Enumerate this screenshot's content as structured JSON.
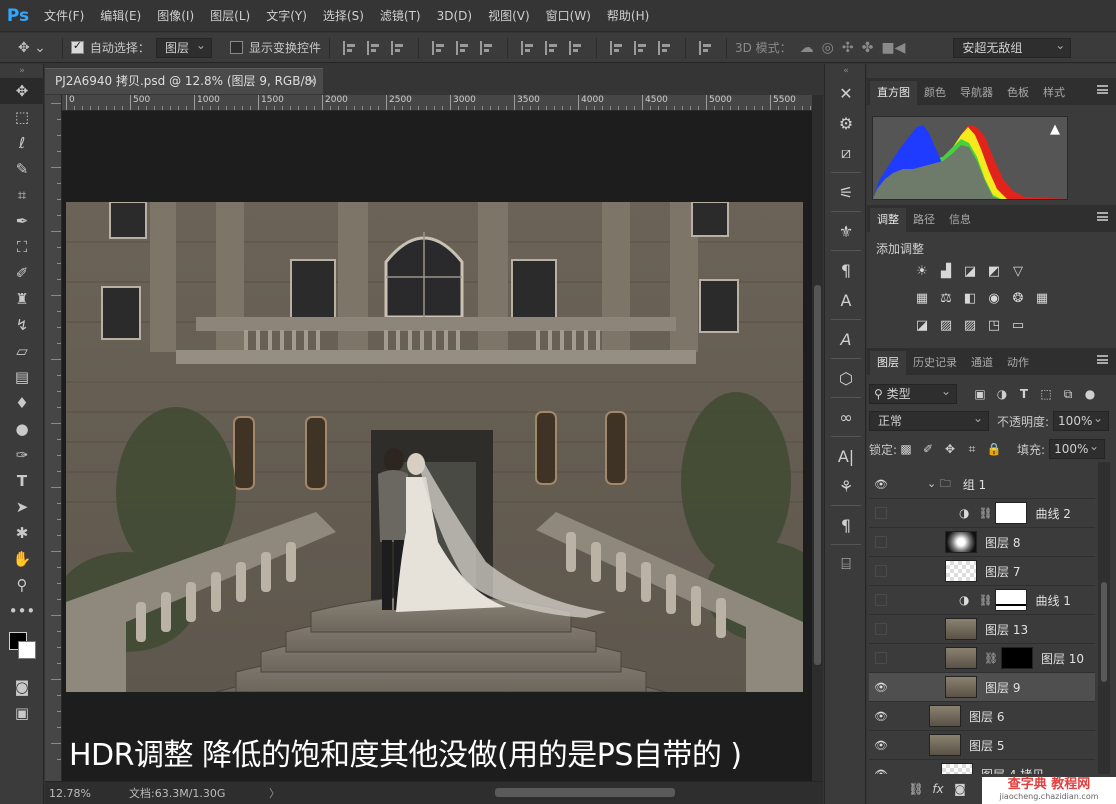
{
  "app": {
    "logo": "Ps"
  },
  "menu": [
    "文件(F)",
    "编辑(E)",
    "图像(I)",
    "图层(L)",
    "文字(Y)",
    "选择(S)",
    "滤镜(T)",
    "3D(D)",
    "视图(V)",
    "窗口(W)",
    "帮助(H)"
  ],
  "options": {
    "auto_select_label": "自动选择：",
    "auto_select_value": "图层",
    "show_transform_label": "显示变换控件",
    "mode3d_label": "3D 模式：",
    "font_value": "安超无敌组"
  },
  "document": {
    "tab_title": "PJ2A6940 拷贝.psd @ 12.8% (图层 9, RGB/8) *",
    "close": "×",
    "ruler_labels": [
      "0",
      "500",
      "1000",
      "1500",
      "2000",
      "2500",
      "3000",
      "3500",
      "4000",
      "4500",
      "5000",
      "5500"
    ],
    "caption": "HDR调整 降低的饱和度其他没做(用的是PS自带的 )"
  },
  "status": {
    "zoom": "12.78%",
    "doc_info": "文档:63.3M/1.30G",
    "arrow": "〉"
  },
  "panels": {
    "top_tabs": [
      "直方图",
      "颜色",
      "导航器",
      "色板",
      "样式"
    ],
    "mid_tabs": [
      "调整",
      "路径",
      "信息"
    ],
    "add_adjustment": "添加调整",
    "layer_tabs": [
      "图层",
      "历史记录",
      "通道",
      "动作"
    ],
    "filter_kind": "类型",
    "blend_mode": "正常",
    "opacity_label": "不透明度:",
    "opacity_value": "100%",
    "lock_label": "锁定:",
    "fill_label": "填充:",
    "fill_value": "100%"
  },
  "layers": [
    {
      "name": "组 1",
      "visible": true,
      "type": "group"
    },
    {
      "name": "曲线 2",
      "visible": false,
      "type": "adjust-white"
    },
    {
      "name": "图层 8",
      "visible": false,
      "type": "glow"
    },
    {
      "name": "图层 7",
      "visible": false,
      "type": "transparent"
    },
    {
      "name": "曲线 1",
      "visible": false,
      "type": "adjust-mask"
    },
    {
      "name": "图层 13",
      "visible": false,
      "type": "photo"
    },
    {
      "name": "图层 10",
      "visible": false,
      "type": "photo-mask"
    },
    {
      "name": "图层 9",
      "visible": true,
      "type": "photo",
      "selected": true
    },
    {
      "name": "图层 6",
      "visible": true,
      "type": "photo"
    },
    {
      "name": "图层 5",
      "visible": true,
      "type": "photo"
    },
    {
      "name": "图层 4 拷贝",
      "visible": true,
      "type": "transparent"
    }
  ],
  "watermark": {
    "main": "查字典 教程网",
    "sub": "jiaocheng.chazidian.com"
  }
}
